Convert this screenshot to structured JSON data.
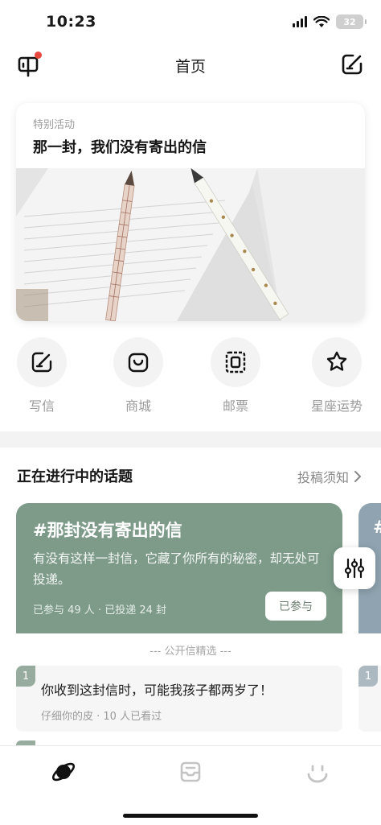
{
  "status_bar": {
    "time": "10:23",
    "battery": "32"
  },
  "nav": {
    "title": "首页"
  },
  "banner": {
    "tag": "特别活动",
    "title": "那一封，我们没有寄出的信"
  },
  "quick_actions": [
    {
      "label": "写信",
      "icon": "write-letter-icon"
    },
    {
      "label": "商城",
      "icon": "shop-bag-icon"
    },
    {
      "label": "邮票",
      "icon": "stamp-icon"
    },
    {
      "label": "星座运势",
      "icon": "star-icon"
    }
  ],
  "topics_section": {
    "title": "正在进行中的话题",
    "link": "投稿须知",
    "card": {
      "title": "#那封没有寄出的信",
      "description": "有没有这样一封信，它藏了你所有的秘密，却无处可投递。",
      "stats": "已参与 49 人 · 已投递 24 封",
      "joined_button": "已参与",
      "color": "#7e9b8a"
    },
    "next_card": {
      "title": "#",
      "color": "#8fa3b0"
    }
  },
  "picks": {
    "label": "--- 公开信精选 ---",
    "items": [
      {
        "rank": "1",
        "title": "你收到这封信时，可能我孩子都两岁了！",
        "meta": "仔细你的皮 · 10 人已看过"
      }
    ],
    "next_rank": "1"
  },
  "tab_bar": {
    "tabs": [
      {
        "icon": "planet-icon",
        "active": true
      },
      {
        "icon": "mailbox-icon",
        "active": false
      },
      {
        "icon": "smiley-icon",
        "active": false
      }
    ]
  },
  "colors": {
    "accent_green": "#7e9b8a",
    "notification_red": "#e5483d"
  }
}
